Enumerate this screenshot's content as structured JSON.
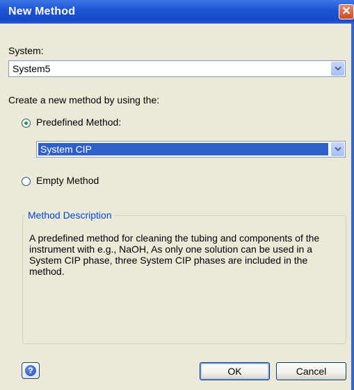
{
  "window": {
    "title": "New Method",
    "close_label": "✕"
  },
  "system": {
    "label": "System:",
    "value": "System5"
  },
  "create": {
    "label": "Create a new method by using the:",
    "predefined_label": "Predefined Method:",
    "predefined_selected": true,
    "predefined_value": "System CIP",
    "empty_label": "Empty Method",
    "empty_selected": false
  },
  "description": {
    "title": "Method Description",
    "text": "A predefined method for cleaning the tubing and components of the instrument with e.g., NaOH, As only one solution can be used in a System CIP phase, three System CIP phases are included in the method."
  },
  "footer": {
    "help_label": "?",
    "ok_label": "OK",
    "cancel_label": "Cancel"
  },
  "colors": {
    "title_bar": "#1f56d6",
    "group_title": "#0046d5",
    "selection": "#2f5fc8"
  },
  "icons": {
    "close": "close-icon",
    "dropdown": "chevron-down-icon",
    "help": "help-icon"
  }
}
